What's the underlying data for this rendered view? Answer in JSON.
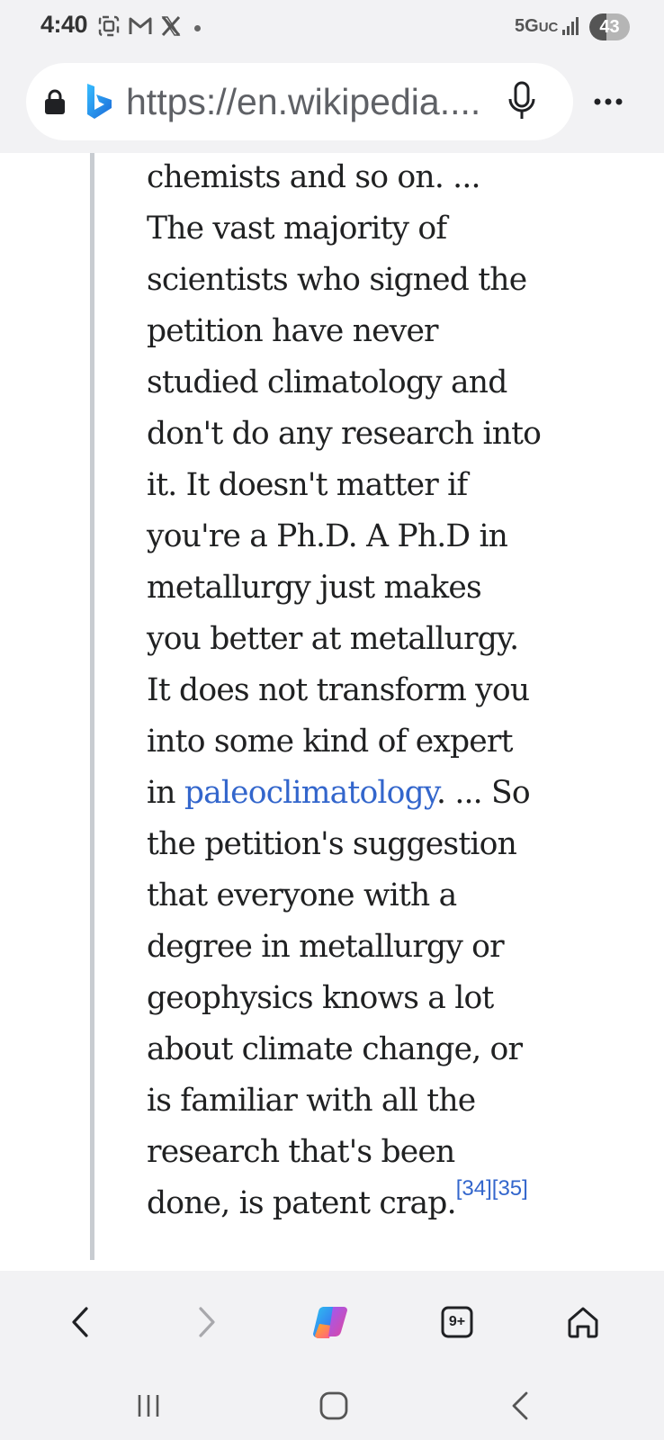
{
  "status_bar": {
    "time": "4:40",
    "network": "5G",
    "network_suffix": "UC",
    "battery_level": "43",
    "icons": [
      "screenshot-icon",
      "gmail-icon",
      "x-icon",
      "dot-icon",
      "signal-icon",
      "battery-icon"
    ]
  },
  "address_bar": {
    "url": "https://en.wikipedia....",
    "icons": [
      "lock-icon",
      "bing-icon",
      "microphone-icon",
      "more-icon"
    ]
  },
  "article": {
    "quote_before_link": "chemists and so on. ... The vast majority of scientists who signed the petition have never studied climatology and don't do any research into it. It doesn't matter if you're a Ph.D. A Ph.D in metallurgy just makes you better at metallurgy. It does not transform you into some kind of expert in ",
    "link_text": "paleoclimatology",
    "quote_after_link": ". ... So the petition's suggestion that everyone with a degree in metallurgy or geophysics knows a lot about climate change, or is familiar with all the research that's been done, is patent crap.",
    "ref_1": "[34]",
    "ref_2": "[35]"
  },
  "browser_nav": {
    "tabs_count": "9+",
    "icons": [
      "back-icon",
      "forward-icon",
      "copilot-icon",
      "tabs-icon",
      "home-icon"
    ]
  },
  "system_nav": {
    "icons": [
      "recents-icon",
      "home-icon",
      "back-icon"
    ]
  },
  "colors": {
    "link": "#3366cc",
    "text": "#202122",
    "quote_rule": "#c8ccd1",
    "chrome_bg": "#f2f2f4"
  }
}
